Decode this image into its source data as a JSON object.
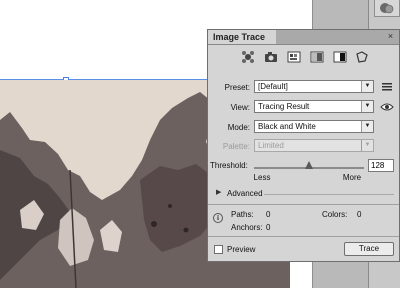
{
  "panel": {
    "title": "Image Trace",
    "close_glyph": "×",
    "preset": {
      "label": "Preset:",
      "value": "[Default]"
    },
    "view": {
      "label": "View:",
      "value": "Tracing Result"
    },
    "mode": {
      "label": "Mode:",
      "value": "Black and White"
    },
    "palette": {
      "label": "Palette:",
      "value": "Limited"
    },
    "threshold": {
      "label": "Threshold:",
      "value": "128",
      "min_label": "Less",
      "max_label": "More",
      "level": 0.5
    },
    "advanced_label": "Advanced",
    "info": {
      "paths_label": "Paths:",
      "paths_value": "0",
      "colors_label": "Colors:",
      "colors_value": "0",
      "anchors_label": "Anchors:",
      "anchors_value": "0"
    },
    "preview_label": "Preview",
    "trace_label": "Trace"
  },
  "icons": [
    "auto-color-icon",
    "high-color-icon",
    "low-color-icon",
    "grayscale-icon",
    "black-white-icon",
    "outline-icon"
  ],
  "colors": {
    "panel_bg": "#d5d5d5",
    "guide": "#5b8fe8",
    "ink": "#5a4c4a",
    "paper": "#e6dbd2"
  }
}
